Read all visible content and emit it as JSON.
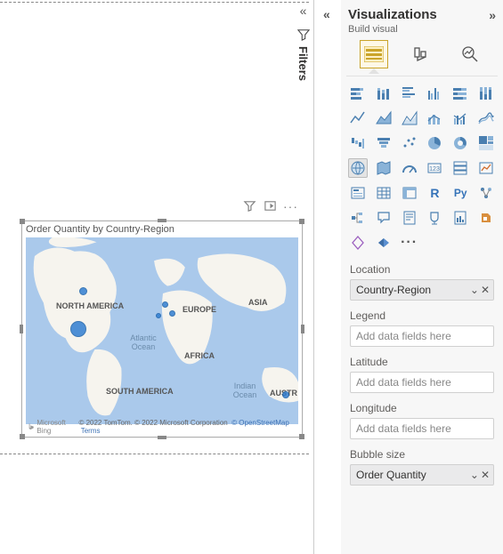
{
  "filters_tab": {
    "label": "Filters"
  },
  "visual": {
    "title": "Order Quantity by Country-Region",
    "labels": {
      "na": "NORTH AMERICA",
      "sa": "SOUTH AMERICA",
      "eu": "EUROPE",
      "af": "AFRICA",
      "as": "ASIA",
      "au": "AUSTR",
      "atlantic": "Atlantic Ocean",
      "indian": "Indian Ocean"
    },
    "attribution": {
      "bing": "Microsoft Bing",
      "copy": "© 2022 TomTom. © 2022 Microsoft Corporation",
      "osm": "© OpenStreetMap",
      "terms": "Terms"
    }
  },
  "panel": {
    "title": "Visualizations",
    "subtitle": "Build visual",
    "fields": {
      "location": {
        "label": "Location",
        "value": "Country-Region"
      },
      "legend": {
        "label": "Legend",
        "placeholder": "Add data fields here"
      },
      "latitude": {
        "label": "Latitude",
        "placeholder": "Add data fields here"
      },
      "longitude": {
        "label": "Longitude",
        "placeholder": "Add data fields here"
      },
      "bubble": {
        "label": "Bubble size",
        "value": "Order Quantity"
      }
    }
  }
}
